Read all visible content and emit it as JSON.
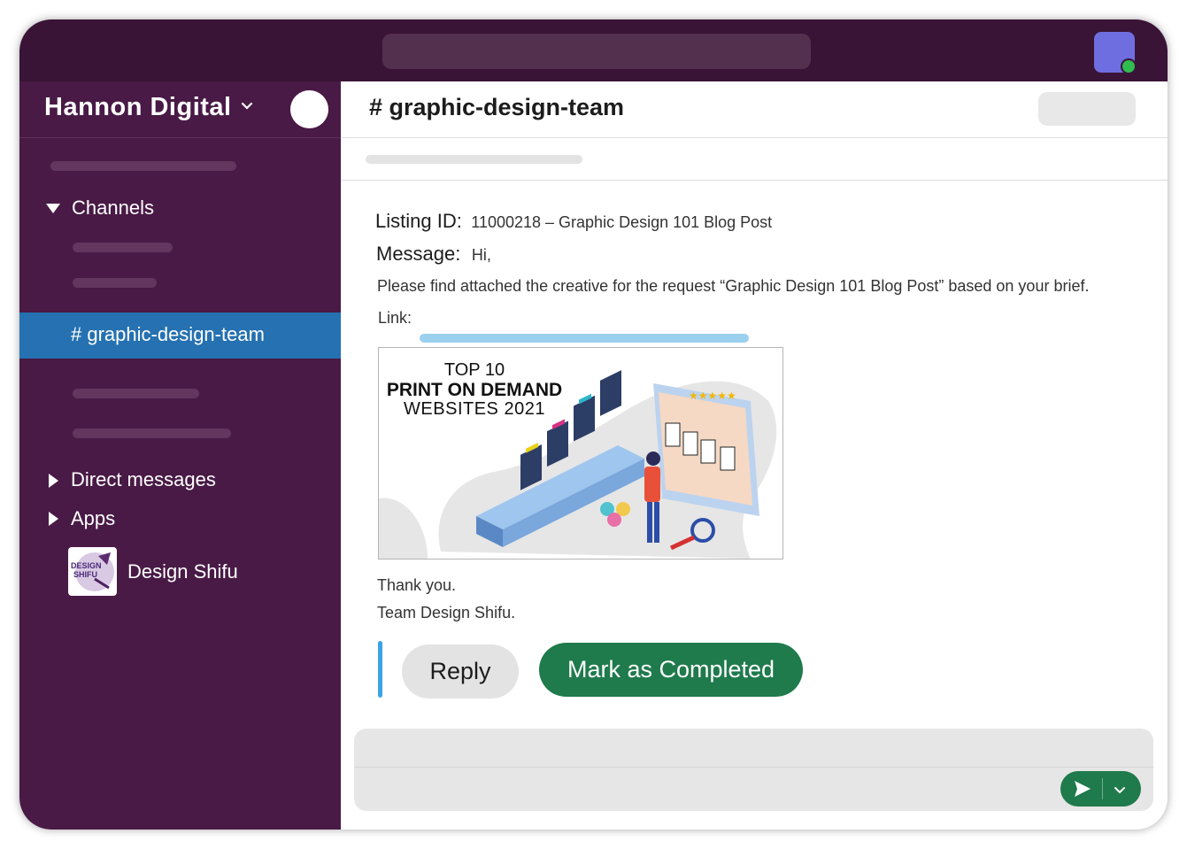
{
  "workspace": {
    "name": "Hannon Digital",
    "chevron_icon": "chevron-down-icon"
  },
  "sidebar": {
    "channels_label": "Channels",
    "active_channel": "# graphic-design-team",
    "direct_messages_label": "Direct messages",
    "apps_label": "Apps",
    "app_item": {
      "name": "Design Shifu",
      "logo_text": "DESIGN SHIFU"
    }
  },
  "channel": {
    "title": "# graphic-design-team"
  },
  "message": {
    "listing_label": "Listing ID:",
    "listing_value": "11000218 – Graphic Design 101 Blog Post",
    "message_label": "Message:",
    "greeting": "Hi,",
    "body": "Please find attached the creative for the request “Graphic Design 101 Blog Post” based on your brief.",
    "link_label": "Link:",
    "attachment": {
      "line1": "TOP 10",
      "line2": "PRINT ON DEMAND",
      "line3": "WEBSITES  2021"
    },
    "closing1": "Thank you.",
    "closing2": "Team Design Shifu."
  },
  "actions": {
    "reply_label": "Reply",
    "complete_label": "Mark as Completed"
  },
  "composer": {
    "send_icon": "send-icon",
    "options_icon": "chevron-down-icon"
  },
  "colors": {
    "topbar": "#3a1436",
    "sidebar": "#491a46",
    "active_channel": "#2571b1",
    "primary_button": "#1f7a4c",
    "online": "#2fbd4f",
    "app_icon": "#6f6ee0"
  }
}
